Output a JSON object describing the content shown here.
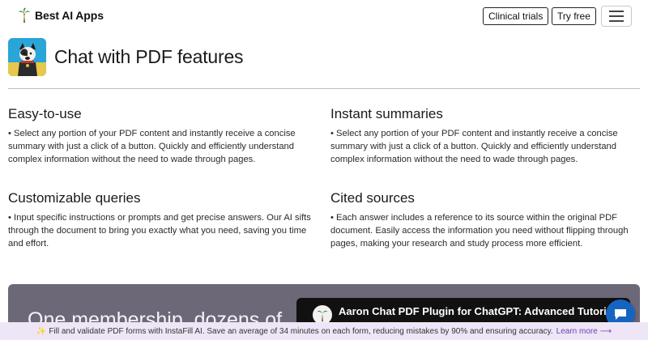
{
  "nav": {
    "brand_name": "Best AI Apps",
    "clinical_label": "Clinical trials",
    "try_label": "Try free",
    "menu_icon": "hamburger-icon"
  },
  "header": {
    "title": "Chat with PDF features",
    "app_icon": "dog-mascot-icon"
  },
  "features": [
    {
      "title": "Easy-to-use",
      "text": "• Select any portion of your PDF content and instantly receive a concise summary with just a click of a button. Quickly and efficiently understand complex information without the need to wade through pages."
    },
    {
      "title": "Instant summaries",
      "text": "• Select any portion of your PDF content and instantly receive a concise summary with just a click of a button. Quickly and efficiently understand complex information without the need to wade through pages."
    },
    {
      "title": "Customizable queries",
      "text": "• Input specific instructions or prompts and get precise answers. Our AI sifts through the document to bring you exactly what you need, saving you time and effort."
    },
    {
      "title": "Cited sources",
      "text": "• Each answer includes a reference to its source within the original PDF document. Easily access the information you need without flipping through pages, making your research and study process more efficient."
    }
  ],
  "promo": {
    "headline": "One membership, dozens of",
    "video_title": "Aaron Chat PDF Plugin for ChatGPT: Advanced Tutorial"
  },
  "banner": {
    "text": "Fill and validate PDF forms with InstaFill AI. Save an average of 34 minutes on each form, reducing mistakes by 90% and ensuring accuracy.",
    "link": "Learn more"
  },
  "colors": {
    "promo_bg": "#6c6878",
    "banner_bg": "#eee6f6",
    "chat_bubble": "#1565c0",
    "link": "#6a3fb2"
  }
}
